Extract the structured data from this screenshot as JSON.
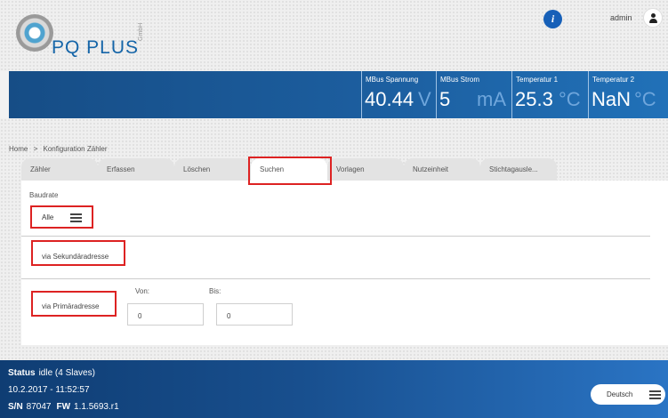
{
  "brand": {
    "logo_text": "PQ PLUS",
    "logo_suffix": "GmbH"
  },
  "header": {
    "info_label": "i",
    "user_label": "admin"
  },
  "measurements": [
    {
      "label": "MBus Spannung",
      "value": "40.44",
      "unit": "V"
    },
    {
      "label": "MBus Strom",
      "value": "5",
      "unit": "mA"
    },
    {
      "label": "Temperatur 1",
      "value": "25.3",
      "unit": "°C"
    },
    {
      "label": "Temperatur 2",
      "value": "NaN",
      "unit": "°C"
    }
  ],
  "breadcrumb": {
    "home": "Home",
    "separator": ">",
    "current": "Konfiguration Zähler"
  },
  "tabs": [
    {
      "label": "Zähler"
    },
    {
      "label": "Erfassen"
    },
    {
      "label": "Löschen"
    },
    {
      "label": "Suchen"
    },
    {
      "label": "Vorlagen"
    },
    {
      "label": "Nutzeinheit"
    },
    {
      "label": "Stichtagausle..."
    }
  ],
  "active_tab": "Suchen",
  "search": {
    "baudrate_label": "Baudrate",
    "baudrate_value": "Alle",
    "secondary_button": "via Sekundäradresse",
    "primary_button": "via Primäradresse",
    "from_label": "Von:",
    "to_label": "Bis:",
    "from_value": "0",
    "to_value": "0"
  },
  "footer": {
    "status_label": "Status",
    "status_value": "idle (4 Slaves)",
    "datetime": "10.2.2017 - 11:52:57",
    "sn_label": "S/N",
    "sn_value": "87047",
    "fw_label": "FW",
    "fw_value": "1.1.5693.r1",
    "language": "Deutsch"
  },
  "colors": {
    "accent_blue": "#1c5e9f",
    "highlight_red": "#dd2222"
  }
}
